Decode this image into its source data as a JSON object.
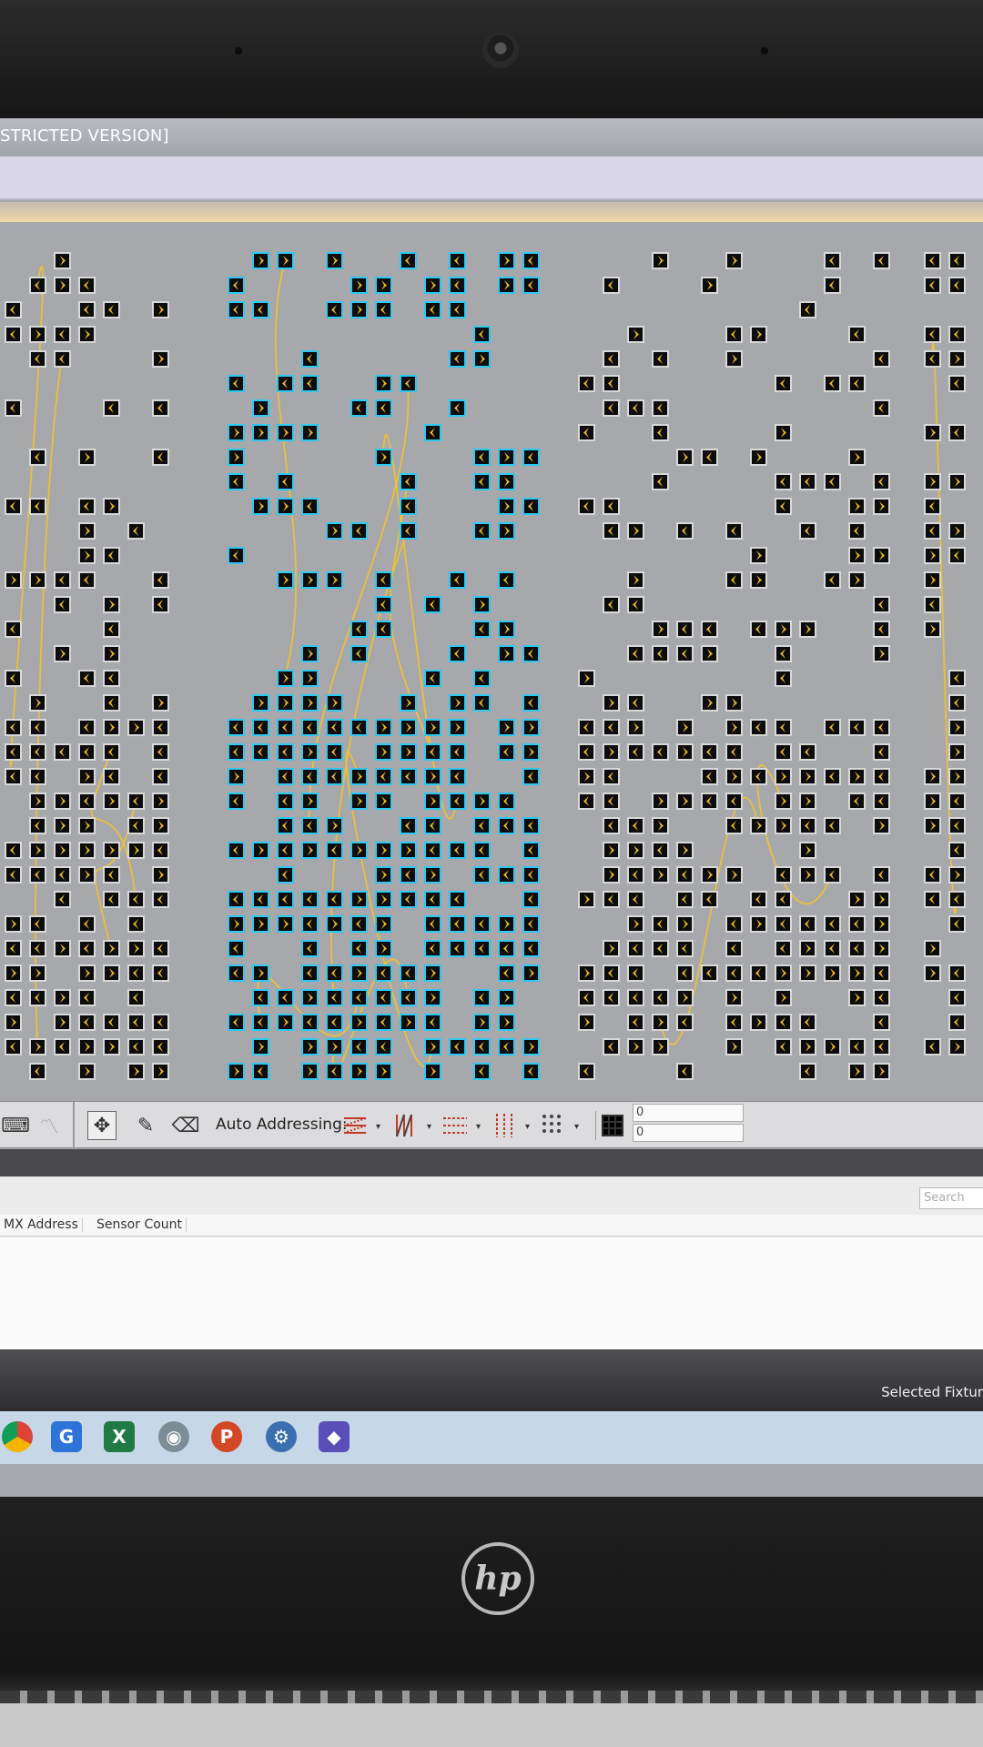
{
  "window": {
    "title": "STRICTED VERSION]"
  },
  "toolbar": {
    "auto_addressing_label": "Auto Addressing:",
    "field_1_value": "0",
    "field_2_value": "0",
    "addressing_modes": [
      "zigzag-rows-icon",
      "zigzag-columns-icon",
      "rows-icon",
      "columns-icon",
      "dots-icon"
    ]
  },
  "panel": {
    "search_placeholder": "Search",
    "columns": [
      "MX Address",
      "Sensor Count"
    ]
  },
  "status": {
    "selected_text": "Selected Fixtur"
  },
  "taskbar": {
    "apps": [
      "chrome-icon",
      "g-app-icon",
      "excel-icon",
      "camera-app-icon",
      "powerpoint-icon",
      "settings-icon",
      "app-icon"
    ]
  },
  "laptop": {
    "brand": "hp"
  },
  "colors": {
    "canvas": "#a7a8ac",
    "fixture": "#0c0c0c",
    "selected_outline": "#2fc8f0",
    "chevron": "#e8b820",
    "wire": "#f2c230"
  }
}
